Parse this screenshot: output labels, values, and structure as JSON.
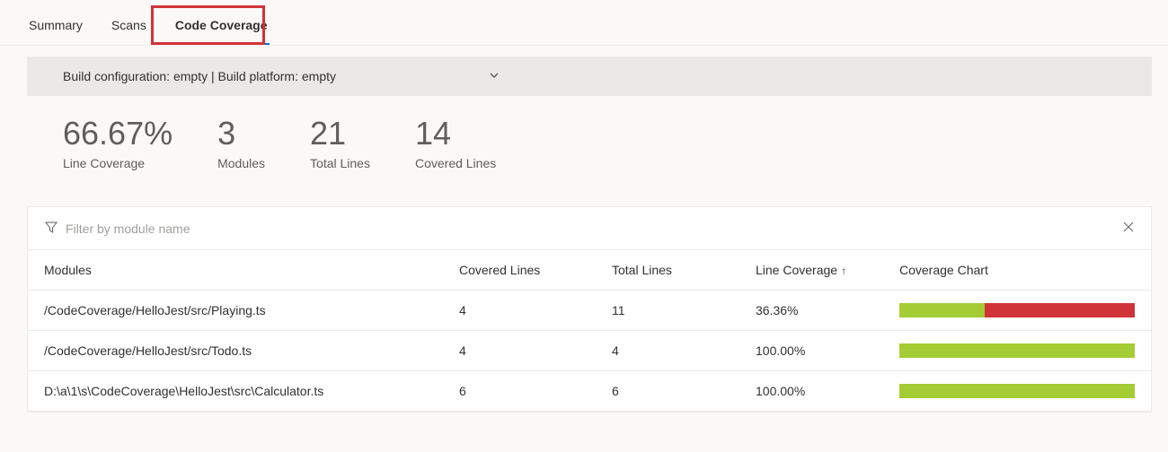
{
  "tabs": {
    "summary": "Summary",
    "scans": "Scans",
    "code_coverage": "Code Coverage"
  },
  "config_bar": {
    "text": "Build configuration: empty | Build platform: empty"
  },
  "stats": {
    "line_coverage": {
      "value": "66.67%",
      "label": "Line Coverage"
    },
    "modules": {
      "value": "3",
      "label": "Modules"
    },
    "total_lines": {
      "value": "21",
      "label": "Total Lines"
    },
    "covered_lines": {
      "value": "14",
      "label": "Covered Lines"
    }
  },
  "filter": {
    "placeholder": "Filter by module name"
  },
  "table": {
    "headers": {
      "modules": "Modules",
      "covered_lines": "Covered Lines",
      "total_lines": "Total Lines",
      "line_coverage": "Line Coverage",
      "coverage_chart": "Coverage Chart"
    },
    "sort_indicator": "↑",
    "rows": [
      {
        "module": "/CodeCoverage/HelloJest/src/Playing.ts",
        "covered": "4",
        "total": "11",
        "coverage": "36.36%",
        "pct": 36.36
      },
      {
        "module": "/CodeCoverage/HelloJest/src/Todo.ts",
        "covered": "4",
        "total": "4",
        "coverage": "100.00%",
        "pct": 100
      },
      {
        "module": "D:\\a\\1\\s\\CodeCoverage\\HelloJest\\src\\Calculator.ts",
        "covered": "6",
        "total": "6",
        "coverage": "100.00%",
        "pct": 100
      }
    ]
  }
}
